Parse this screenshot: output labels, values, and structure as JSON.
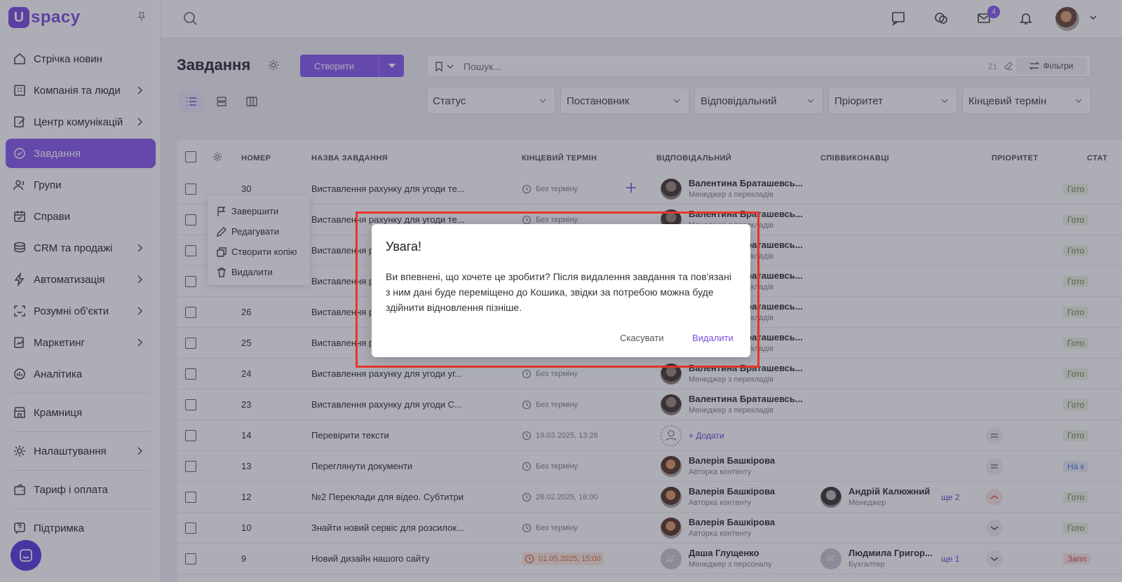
{
  "brand": {
    "mark": "U",
    "name": "spacy"
  },
  "sidebar": {
    "items": [
      {
        "label": "Стрічка новин",
        "chevron": false
      },
      {
        "label": "Компанія та люди",
        "chevron": true
      },
      {
        "label": "Центр комунікацій",
        "chevron": true
      },
      {
        "label": "Завдання",
        "chevron": false,
        "active": true
      },
      {
        "label": "Групи",
        "chevron": false
      },
      {
        "label": "Справи",
        "chevron": false
      },
      {
        "label": "CRM та продажі",
        "chevron": true
      },
      {
        "label": "Автоматизація",
        "chevron": true
      },
      {
        "label": "Розумні об'єкти",
        "chevron": true
      },
      {
        "label": "Маркетинг",
        "chevron": true
      },
      {
        "label": "Аналітика",
        "chevron": false
      },
      {
        "label": "Крамниця",
        "chevron": false
      },
      {
        "label": "Налаштування",
        "chevron": true
      },
      {
        "label": "Тариф і оплата",
        "chevron": false
      },
      {
        "label": "Підтримка",
        "chevron": false
      }
    ]
  },
  "topbar": {
    "mail_badge": "4"
  },
  "page": {
    "title": "Завдання",
    "create_label": "Створити"
  },
  "search": {
    "placeholder": "Пошук...",
    "count": "21",
    "filters_label": "Фільтри"
  },
  "filters": [
    "Статус",
    "Постановник",
    "Відповідальний",
    "Пріоритет",
    "Кінцевий термін"
  ],
  "table": {
    "headers": {
      "number": "НОМЕР",
      "name": "НАЗВА ЗАВДАННЯ",
      "deadline": "КІНЦЕВИЙ ТЕРМІН",
      "responsible": "ВІДПОВІДАЛЬНИЙ",
      "coexec": "СПІВВИКОНАВЦІ",
      "priority": "ПРІОРИТЕТ",
      "status": "СТАТ"
    },
    "rows": [
      {
        "num": "30",
        "name": "Виставлення рахунку для угоди те...",
        "deadline": "Без терміну",
        "person": "Валентина Браташевсь...",
        "role": "Менеджер з перекладів",
        "status": "Гото"
      },
      {
        "num": "",
        "name": "Виставлення рахунку для угоди те...",
        "deadline": "Без терміну",
        "person": "Валентина Браташевсь...",
        "role": "Менеджер з перекладів",
        "status": "Гото"
      },
      {
        "num": "",
        "name": "Виставлення р...",
        "deadline": "",
        "person": "Валентина Браташевсь...",
        "role": "Менеджер з перекладів",
        "status": "Гото"
      },
      {
        "num": "",
        "name": "Виставлення р...",
        "deadline": "",
        "person": "Валентина Браташевсь...",
        "role": "Менеджер з перекладів",
        "status": "Гото"
      },
      {
        "num": "26",
        "name": "Виставлення р...",
        "deadline": "",
        "person": "Валентина Браташевсь...",
        "role": "Менеджер з перекладів",
        "status": "Гото"
      },
      {
        "num": "25",
        "name": "Виставлення р...",
        "deadline": "",
        "person": "Валентина Браташевсь...",
        "role": "Менеджер з перекладів",
        "status": "Гото"
      },
      {
        "num": "24",
        "name": "Виставлення рахунку для угоди уг...",
        "deadline": "Без терміну",
        "person": "Валентина Браташевсь...",
        "role": "Менеджер з перекладів",
        "status": "Гото"
      },
      {
        "num": "23",
        "name": "Виставлення рахунку для угоди С...",
        "deadline": "Без терміну",
        "person": "Валентина Браташевсь...",
        "role": "Менеджер з перекладів",
        "status": "Гото"
      },
      {
        "num": "14",
        "name": "Перевірити тексти",
        "deadline": "19.03.2025, 13:26",
        "add": "Додати",
        "status": "Гото"
      },
      {
        "num": "13",
        "name": "Переглянути документи",
        "deadline": "Без терміну",
        "person": "Валерія Башкірова",
        "role": "Авторка контенту",
        "status": "На к"
      },
      {
        "num": "12",
        "name": "№2 Переклади для відео. Субтитри",
        "deadline": "28.02.2025, 16:00",
        "person": "Валерія Башкірова",
        "role": "Авторка контенту",
        "co_person": "Андрій Калюжний",
        "co_role": "Менеджер",
        "more": "ще 2",
        "status": "Гото"
      },
      {
        "num": "10",
        "name": "Знайти новий сервіс для розсилок...",
        "deadline": "Без терміну",
        "person": "Валерія Башкірова",
        "role": "Авторка контенту",
        "status": "Гото"
      },
      {
        "num": "9",
        "name": "Новий дизайн нашого сайту",
        "deadline": "01.05.2025, 15:00",
        "person": "Даша Глущенко",
        "role": "Менеджер з персоналу",
        "initials": "ДГ",
        "co_person": "Людмила Григор...",
        "co_role": "Бухгалтер",
        "co_initials": "ЛГ",
        "more": "ще 1",
        "status": "Запл"
      }
    ]
  },
  "context_menu": [
    "Завершити",
    "Редагувати",
    "Створити копію",
    "Видалити"
  ],
  "modal": {
    "title": "Увага!",
    "text": "Ви впевнені, що хочете це зробити? Після видалення завдання та пов'язані з ним дані буде переміщено до Кошика, звідки за потребою можна буде здійнити відновлення пізніше.",
    "cancel": "Скасувати",
    "delete": "Видалити"
  }
}
